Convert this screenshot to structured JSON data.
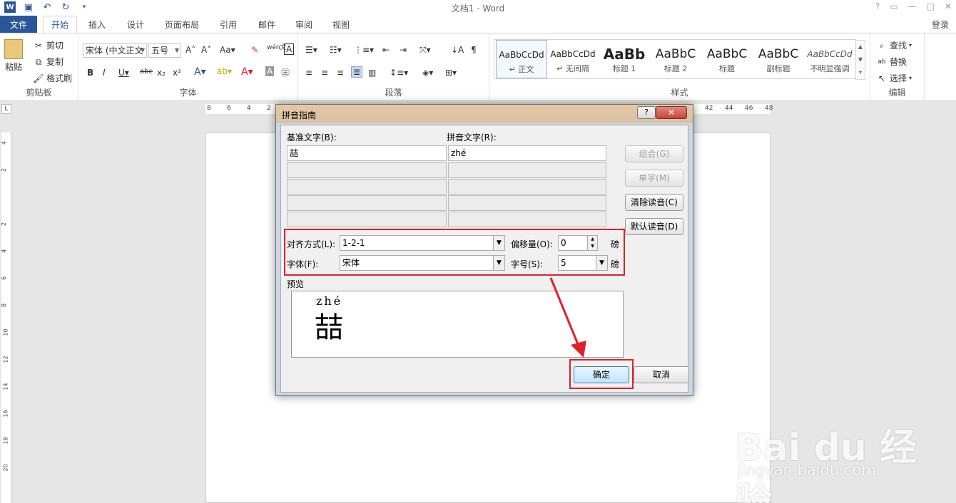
{
  "window": {
    "title": "文档1 - Word",
    "help": "?",
    "login": "登录"
  },
  "tabs": [
    "文件",
    "开始",
    "插入",
    "设计",
    "页面布局",
    "引用",
    "邮件",
    "审阅",
    "视图"
  ],
  "ribbon": {
    "clipboard": {
      "label": "剪贴板",
      "paste": "粘贴",
      "cut": "剪切",
      "copy": "复制",
      "painter": "格式刷"
    },
    "font": {
      "label": "字体",
      "name": "宋体 (中文正文",
      "size": "五号"
    },
    "paragraph": {
      "label": "段落"
    },
    "styles": {
      "label": "样式",
      "items": [
        {
          "sample": "AaBbCcDd",
          "name": "↵ 正文"
        },
        {
          "sample": "AaBbCcDd",
          "name": "↵ 无间隔"
        },
        {
          "sample": "AaBb",
          "name": "标题 1"
        },
        {
          "sample": "AaBbC",
          "name": "标题 2"
        },
        {
          "sample": "AaBbC",
          "name": "标题"
        },
        {
          "sample": "AaBbC",
          "name": "副标题"
        },
        {
          "sample": "AaBbCcDd",
          "name": "不明显强调"
        }
      ]
    },
    "editing": {
      "label": "编辑",
      "find": "查找",
      "replace": "替换",
      "select": "选择"
    }
  },
  "ruler": {
    "h": [
      "8",
      "6",
      "4",
      "2",
      "42",
      "44",
      "46",
      "48"
    ],
    "v": [
      "4",
      "2",
      "2",
      "4",
      "6",
      "8",
      "10",
      "12",
      "14",
      "16",
      "18",
      "20"
    ]
  },
  "dialog": {
    "title": "拼音指南",
    "help": "?",
    "close": "✕",
    "base_label": "基准文字(B):",
    "ruby_label": "拼音文字(R):",
    "rows": [
      {
        "base": "喆",
        "ruby": "zhé"
      },
      {
        "base": "",
        "ruby": ""
      },
      {
        "base": "",
        "ruby": ""
      },
      {
        "base": "",
        "ruby": ""
      },
      {
        "base": "",
        "ruby": ""
      }
    ],
    "buttons": {
      "group": "组合(G)",
      "mono": "单字(M)",
      "clear": "清除读音(C)",
      "default": "默认读音(D)"
    },
    "alignment_label": "对齐方式(L):",
    "alignment_value": "1-2-1",
    "offset_label": "偏移量(O):",
    "offset_value": "0",
    "unit": "磅",
    "font_label": "字体(F):",
    "font_value": "宋体",
    "size_label": "字号(S):",
    "size_value": "5",
    "preview_label": "预览",
    "preview_ruby": "zhé",
    "preview_base": "喆",
    "ok": "确定",
    "cancel": "取消"
  },
  "watermark": {
    "logo": "Bai du 经验",
    "url": "jingyan.baidu.com"
  }
}
